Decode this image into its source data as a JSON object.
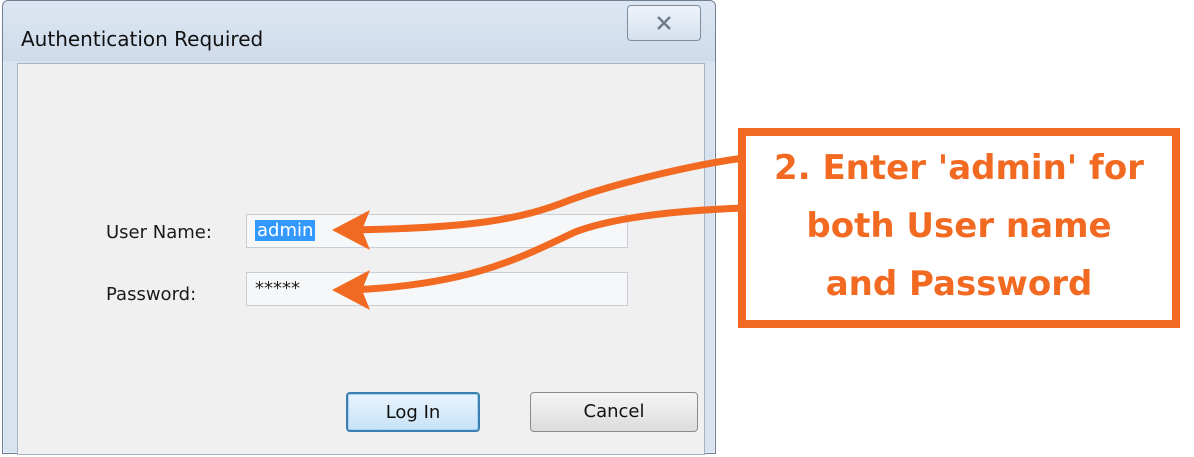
{
  "dialog": {
    "title": "Authentication Required",
    "close_icon": "close-icon"
  },
  "form": {
    "username_label": "User Name:",
    "username_value": "admin",
    "password_label": "Password:",
    "password_value": "*****"
  },
  "buttons": {
    "login_label": "Log In",
    "cancel_label": "Cancel"
  },
  "annotation": {
    "line1": "2. Enter 'admin' for",
    "line2": "both User name",
    "line3": "and Password"
  },
  "colors": {
    "accent": "#f26a21",
    "selection": "#3399ff"
  }
}
